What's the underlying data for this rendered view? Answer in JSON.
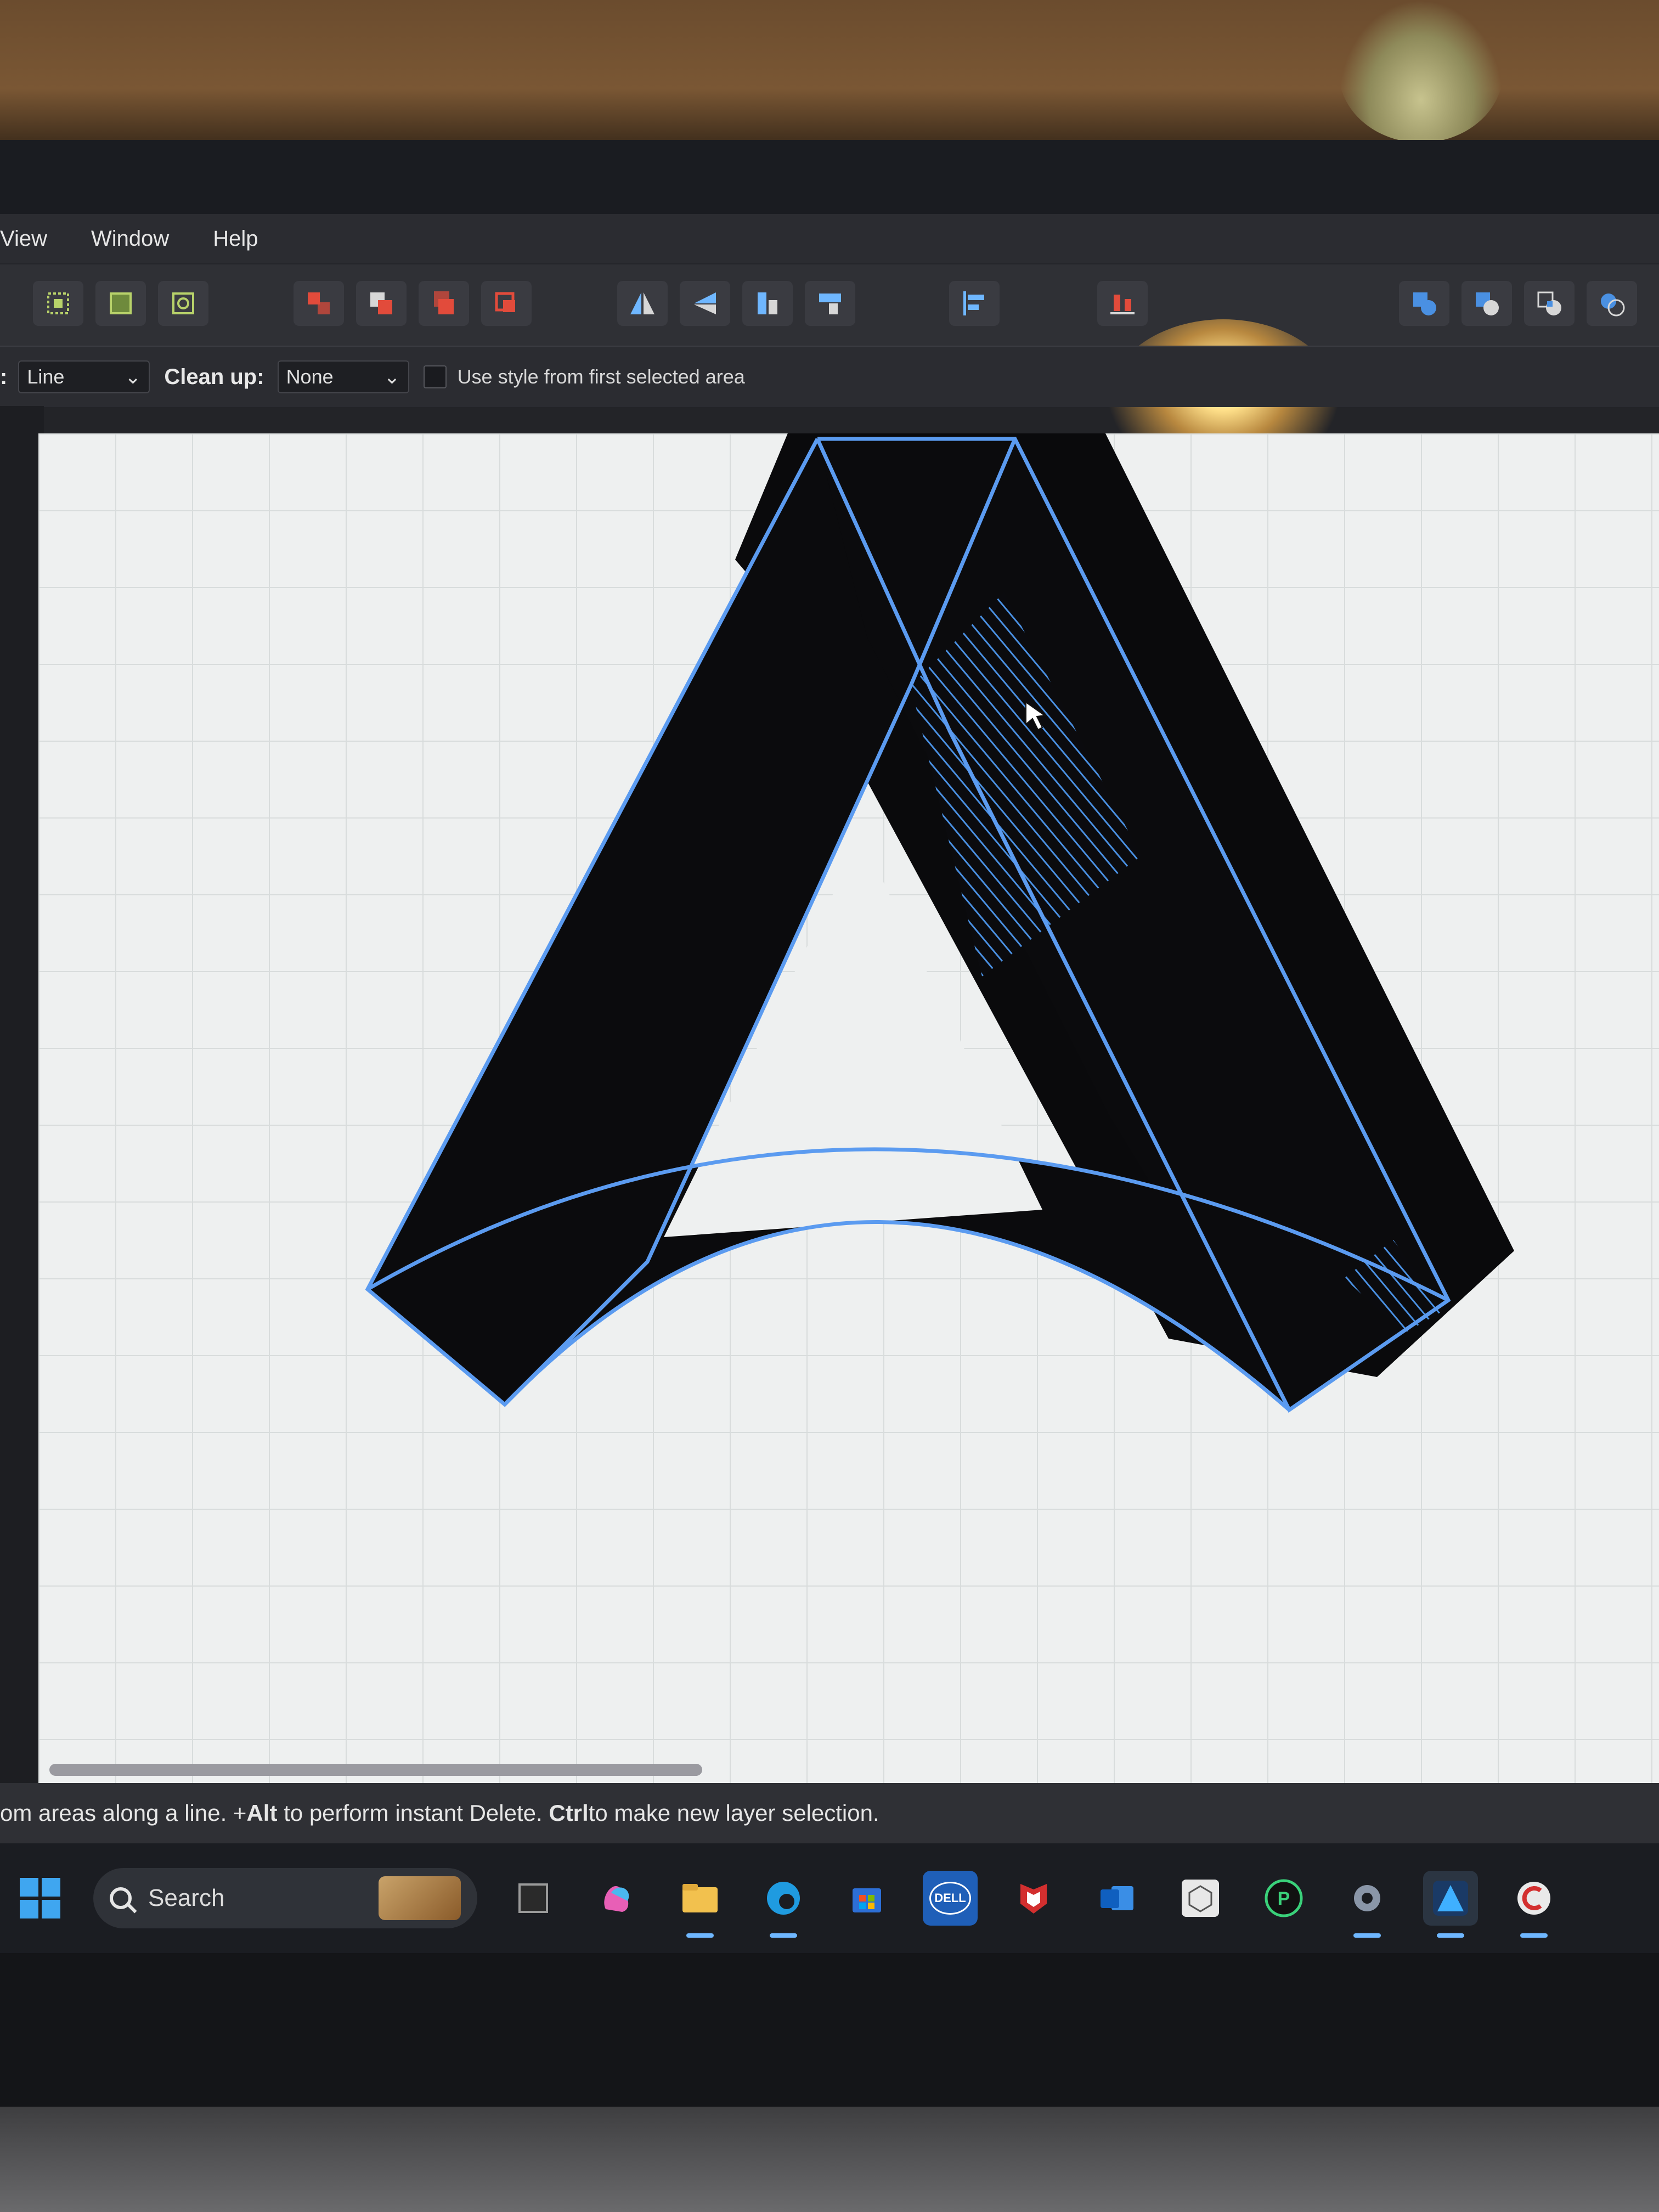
{
  "menu": {
    "items": [
      "View",
      "Window",
      "Help"
    ]
  },
  "toolbar": {
    "group1": [
      "select-all-icon",
      "select-none-icon",
      "select-object-icon"
    ],
    "group2": [
      "bring-forward-icon",
      "send-backward-icon",
      "arrange-front-icon",
      "arrange-back-icon"
    ],
    "group3": [
      "flip-horizontal-icon",
      "flip-vertical-icon",
      "rotate-left-icon",
      "rotate-right-icon"
    ],
    "group4": [
      "align-icon"
    ],
    "group5": [
      "distribute-icon"
    ],
    "group6": [
      "boolean-add-icon",
      "boolean-subtract-icon",
      "boolean-intersect-icon",
      "boolean-divide-icon"
    ]
  },
  "contextbar": {
    "mode_prefix": ":",
    "mode_value": "Line",
    "cleanup_label": "Clean up:",
    "cleanup_value": "None",
    "use_style_label": "Use style from first selected area"
  },
  "statusbar": {
    "part1": "om areas along a line. +",
    "key1": "Alt",
    "part2": " to perform instant Delete. ",
    "key2": "Ctrl",
    "part3": " to make new layer selection."
  },
  "taskbar": {
    "search_placeholder": "Search",
    "apps": [
      "terminal-icon",
      "copilot-icon",
      "file-explorer-icon",
      "edge-icon",
      "store-icon",
      "dell-icon",
      "mcafee-icon",
      "outlook-icon",
      "3d-viewer-icon",
      "p-app-icon",
      "settings-icon",
      "affinity-designer-icon",
      "c-app-icon"
    ],
    "dell_text": "DELL",
    "outlook_text": "O",
    "p_text": "P"
  },
  "colors": {
    "accent": "#4a90e2",
    "selection_stroke": "#5b9bf0",
    "artwork_fill": "#0a0a0c",
    "canvas": "#eef0f0",
    "ui_dark": "#2b2c31"
  }
}
